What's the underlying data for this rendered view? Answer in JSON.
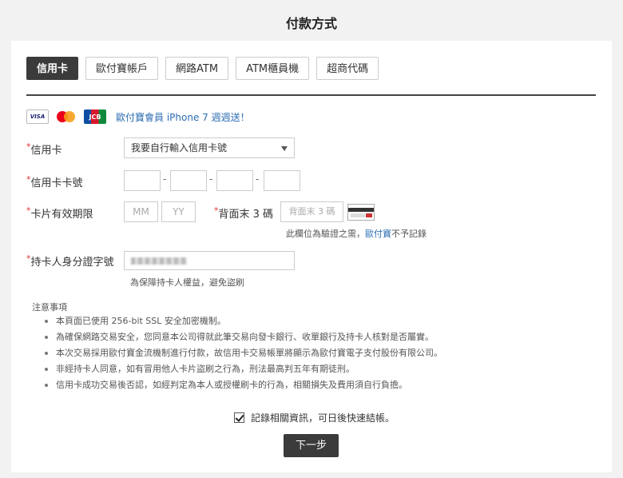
{
  "page": {
    "title": "付款方式"
  },
  "tabs": [
    "信用卡",
    "歐付寶帳戶",
    "網路ATM",
    "ATM櫃員機",
    "超商代碼"
  ],
  "cards": {
    "visa": "VISA",
    "jcb": "JCB"
  },
  "promo": "歐付寶會員 iPhone 7 週週送！",
  "form": {
    "required_mark": "*",
    "card_label": "信用卡",
    "card_select_value": "我要自行輸入信用卡號",
    "card_number_label": "信用卡卡號",
    "expiry_label": "卡片有效期限",
    "month_placeholder": "MM",
    "year_placeholder": "YY",
    "cvv_label": "背面末 3 碼",
    "cvv_placeholder": "背面末 3 碼",
    "cvv_note_prefix": "此欄位為驗證之需，",
    "cvv_note_link": "歐付寶",
    "cvv_note_suffix": "不予記錄",
    "id_label": "持卡人身分證字號",
    "id_note": "為保障持卡人權益，避免盜刷",
    "dash": "-"
  },
  "notice": {
    "title": "注意事項",
    "items": [
      "本頁面已使用 256-bit SSL 安全加密機制。",
      "為確保網路交易安全，您同意本公司得就此筆交易向發卡銀行、收單銀行及持卡人核對是否屬實。",
      "本次交易採用歐付寶金流機制進行付款，故信用卡交易帳單將顯示為歐付寶電子支付股份有限公司。",
      "非經持卡人同意，如有冒用他人卡片盜刷之行為，刑法最高判五年有期徒刑。",
      "信用卡成功交易後否認，如經判定為本人或授權刷卡的行為，相關損失及費用須自行負擔。"
    ]
  },
  "remember_label": "記錄相關資訊，可日後快速結帳。",
  "next_button": "下一步"
}
